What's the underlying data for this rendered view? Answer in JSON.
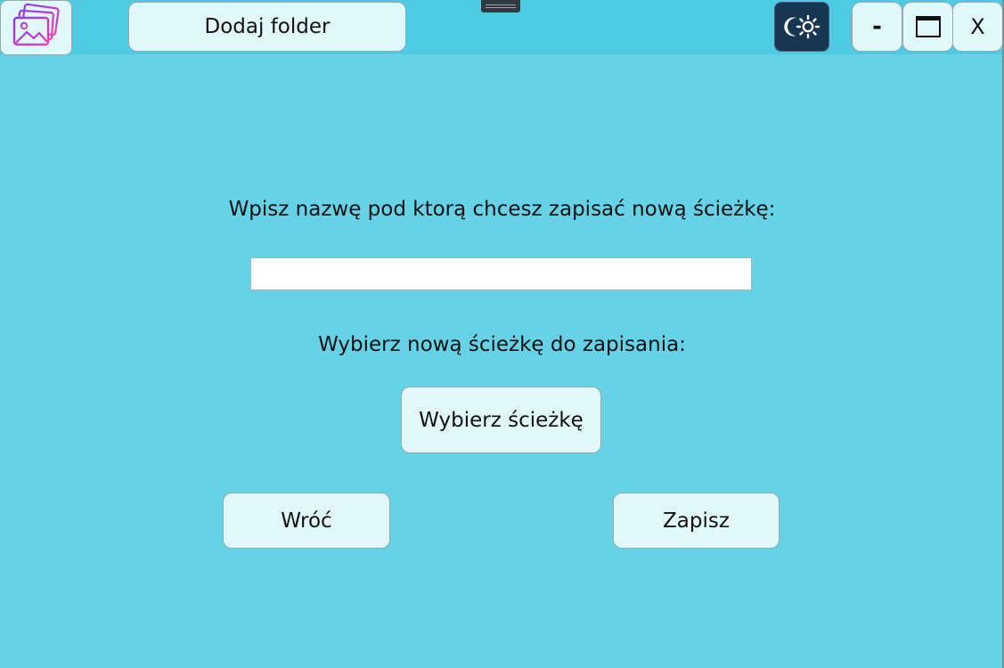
{
  "titlebar": {
    "add_folder_label": "Dodaj folder",
    "theme_icon": "moon-sun-icon",
    "minimize_label": "-",
    "maximize_icon": "maximize-icon",
    "close_label": "X"
  },
  "app_icon": "gallery-images-icon",
  "form": {
    "name_prompt": "Wpisz nazwę pod ktorą chcesz zapisać nową ścieżkę:",
    "name_value": "",
    "name_placeholder": "",
    "path_prompt": "Wybierz nową ścieżkę do zapisania:",
    "choose_path_label": "Wybierz ścieżkę",
    "back_label": "Wróć",
    "save_label": "Zapisz"
  },
  "colors": {
    "background": "#66d2e6",
    "titlebar": "#4ecbe2",
    "button": "#e0f7fb",
    "theme_button": "#163654"
  }
}
